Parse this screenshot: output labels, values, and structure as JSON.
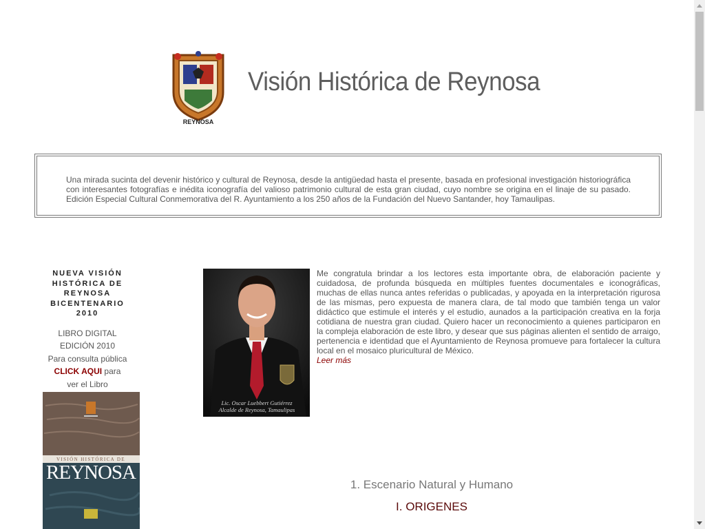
{
  "header": {
    "title": "Visión Histórica de Reynosa",
    "logo_caption": "REYNOSA"
  },
  "intro": {
    "text": "Una mirada sucinta del devenir histórico y cultural de Reynosa, desde la antigüedad hasta el presente, basada en profesional investigación historiográfica con interesantes fotografías e inédita iconografía del valioso patrimonio cultural de esta gran ciudad, cuyo nombre se origina en el linaje de su pasado. Edición Especial Cultural Conmemorativa del R. Ayuntamiento a los 250 años de la Fundación del Nuevo Santander, hoy Tamaulipas."
  },
  "sidebar": {
    "heading": "NUEVA VISIÓN HISTÓRICA DE REYNOSA BICENTENARIO 2010",
    "line1": "LIBRO DIGITAL",
    "line2": "EDICIÓN 2010",
    "line3": "Para consulta pública",
    "click_here": "CLICK AQUI",
    "click_suffix": " para",
    "line5": "ver el Libro",
    "book_title_small": "VISIÓN HISTÓRICA DE",
    "book_title_big": "REYNOSA"
  },
  "main": {
    "photo_caption_1": "Lic. Oscar Luebbert Gutiérrez",
    "photo_caption_2": "Alcalde de Reynosa, Tamaulipas",
    "message": "Me congratula brindar a los lectores esta importante obra, de elaboración paciente y cuidadosa, de profunda búsqueda en múltiples fuentes documentales e iconográficas, muchas de ellas nunca antes referidas o publicadas, y apoyada en la interpretación rigurosa de las mismas, pero expuesta de manera clara, de tal modo que también tenga un valor didáctico que estimule el interés y el estudio, aunados a la participación creativa en la forja cotidiana de nuestra gran ciudad. Quiero hacer un reconocimiento a quienes participaron en la compleja elaboración de este libro, y desear que sus páginas alienten el sentido de arraigo, pertenencia e identidad que el Ayuntamiento de Reynosa promueve para fortalecer la cultura local en el mosaico pluricultural de México.",
    "read_more": "Leer más",
    "section_1": "1. Escenario Natural y Humano",
    "section_2": "I. ORIGENES"
  },
  "colors": {
    "link": "#8b0000",
    "text": "#555555",
    "title": "#5e5e5e"
  }
}
